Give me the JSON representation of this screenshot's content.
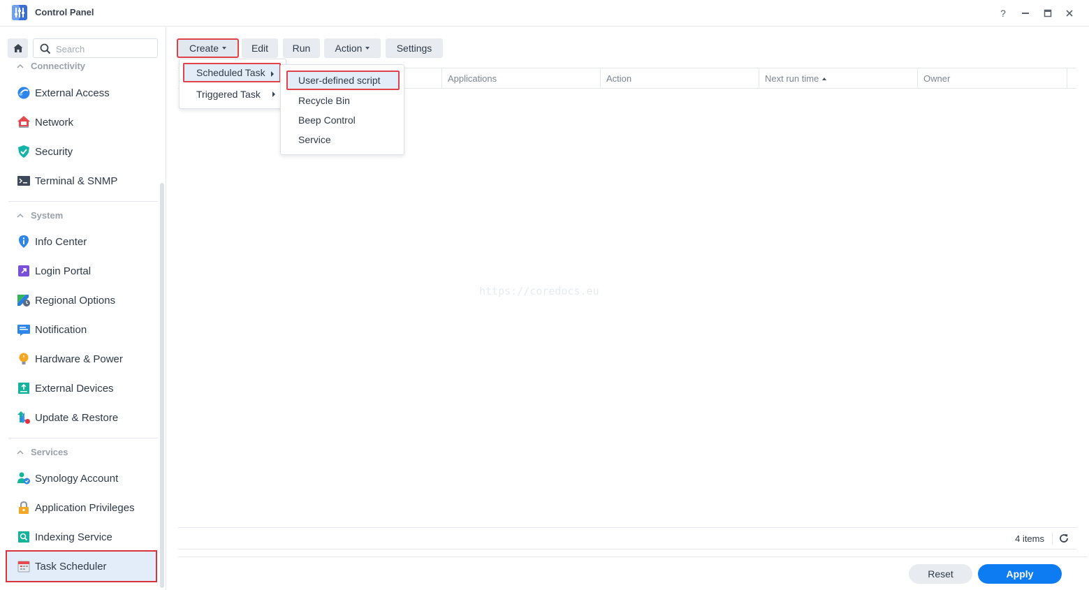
{
  "window": {
    "title": "Control Panel",
    "controls": {
      "help": "?",
      "minimize": "—",
      "maximize": "□",
      "close": "✕"
    }
  },
  "sidebar": {
    "search_placeholder": "Search",
    "sections": [
      {
        "title": "Connectivity",
        "items": [
          {
            "label": "External Access",
            "icon": "external-access-icon"
          },
          {
            "label": "Network",
            "icon": "network-icon"
          },
          {
            "label": "Security",
            "icon": "security-shield-icon"
          },
          {
            "label": "Terminal & SNMP",
            "icon": "terminal-icon"
          }
        ]
      },
      {
        "title": "System",
        "items": [
          {
            "label": "Info Center",
            "icon": "info-center-icon"
          },
          {
            "label": "Login Portal",
            "icon": "login-portal-icon"
          },
          {
            "label": "Regional Options",
            "icon": "regional-options-icon"
          },
          {
            "label": "Notification",
            "icon": "notification-icon"
          },
          {
            "label": "Hardware & Power",
            "icon": "hardware-power-icon"
          },
          {
            "label": "External Devices",
            "icon": "external-devices-icon"
          },
          {
            "label": "Update & Restore",
            "icon": "update-restore-icon"
          }
        ]
      },
      {
        "title": "Services",
        "items": [
          {
            "label": "Synology Account",
            "icon": "synology-account-icon"
          },
          {
            "label": "Application Privileges",
            "icon": "application-privileges-icon"
          },
          {
            "label": "Indexing Service",
            "icon": "indexing-service-icon"
          },
          {
            "label": "Task Scheduler",
            "icon": "task-scheduler-icon",
            "active": true
          }
        ]
      }
    ]
  },
  "toolbar": {
    "create": "Create",
    "edit": "Edit",
    "run": "Run",
    "action": "Action",
    "settings": "Settings"
  },
  "create_menu": {
    "items": [
      "Scheduled Task",
      "Triggered Task"
    ]
  },
  "scheduled_submenu": {
    "items": [
      "User-defined script",
      "Recycle Bin",
      "Beep Control",
      "Service"
    ]
  },
  "grid": {
    "columns": [
      "Applications",
      "Action",
      "Next run time",
      "Owner"
    ]
  },
  "watermark": "https://coredocs.eu",
  "pager": {
    "count": "4 items"
  },
  "footer": {
    "reset": "Reset",
    "apply": "Apply"
  },
  "colors": {
    "accent": "#0d7cf2",
    "highlight": "#e1424a",
    "active_bg": "#e3edf9"
  }
}
